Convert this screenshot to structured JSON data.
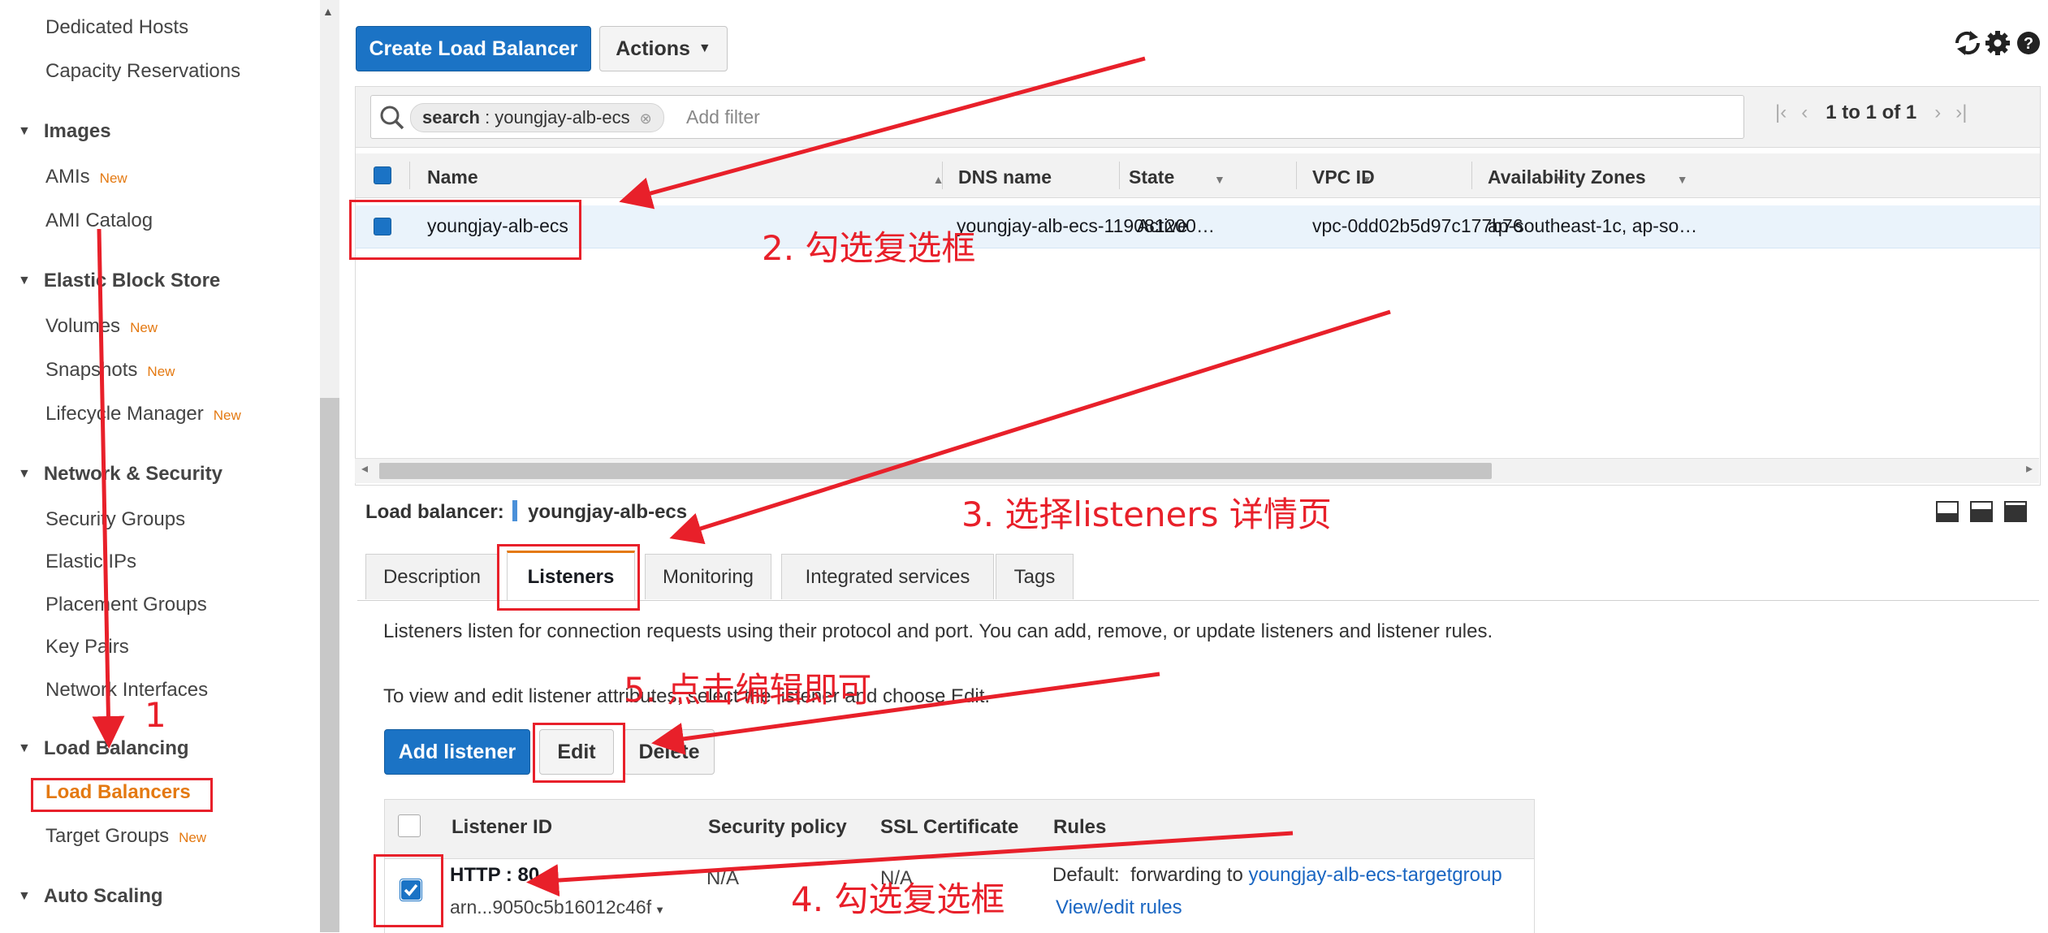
{
  "sidebar": {
    "items_top": [
      "Dedicated Hosts",
      "Capacity Reservations"
    ],
    "images": {
      "title": "Images",
      "items": [
        {
          "label": "AMIs",
          "badge": "New"
        },
        {
          "label": "AMI Catalog",
          "badge": ""
        }
      ]
    },
    "ebs": {
      "title": "Elastic Block Store",
      "items": [
        {
          "label": "Volumes",
          "badge": "New"
        },
        {
          "label": "Snapshots",
          "badge": "New"
        },
        {
          "label": "Lifecycle Manager",
          "badge": "New"
        }
      ]
    },
    "netsec": {
      "title": "Network & Security",
      "items": [
        {
          "label": "Security Groups"
        },
        {
          "label": "Elastic IPs"
        },
        {
          "label": "Placement Groups"
        },
        {
          "label": "Key Pairs"
        },
        {
          "label": "Network Interfaces"
        }
      ]
    },
    "lb": {
      "title": "Load Balancing",
      "items": [
        {
          "label": "Load Balancers",
          "badge": ""
        },
        {
          "label": "Target Groups",
          "badge": "New"
        }
      ]
    },
    "autoscaling": {
      "title": "Auto Scaling"
    }
  },
  "toolbar": {
    "create_label": "Create Load Balancer",
    "actions_label": "Actions"
  },
  "filter": {
    "chip_key": "search",
    "chip_sep": " : ",
    "chip_value": "youngjay-alb-ecs",
    "placeholder": "Add filter",
    "pagination": "1 to 1 of 1"
  },
  "table": {
    "columns": [
      "Name",
      "DNS name",
      "State",
      "VPC ID",
      "Availability Zones"
    ],
    "row": {
      "name": "youngjay-alb-ecs",
      "dns": "youngjay-alb-ecs-119081200…",
      "state": "Active",
      "vpc": "vpc-0dd02b5d97c177b76",
      "azs": "ap-southeast-1c, ap-so…"
    }
  },
  "details": {
    "lb_label": "Load balancer:",
    "lb_name": "youngjay-alb-ecs",
    "tabs": [
      "Description",
      "Listeners",
      "Monitoring",
      "Integrated services",
      "Tags"
    ],
    "intro": "Listeners listen for connection requests using their protocol and port. You can add, remove, or update listeners and listener rules.",
    "hint": "To view and edit listener attributes, select the listener and choose Edit.",
    "add_label": "Add listener",
    "edit_label": "Edit",
    "delete_label": "Delete",
    "lis_columns": [
      "Listener ID",
      "Security policy",
      "SSL Certificate",
      "Rules"
    ],
    "listener": {
      "id": "HTTP : 80",
      "arn": "arn...9050c5b16012c46f",
      "policy": "N/A",
      "cert": "N/A",
      "default_label": "Default:",
      "forward_label": "forwarding to",
      "target": "youngjay-alb-ecs-targetgroup",
      "view_rules": "View/edit rules"
    }
  },
  "annotations": {
    "step1": "1",
    "step2": "2. 勾选复选框",
    "step3": "3. 选择listeners 详情页",
    "step4": "4. 勾选复选框",
    "step5": "5. 点击编辑即可"
  },
  "colors": {
    "accent": "#e47911",
    "primary": "#1b73c5",
    "annotation": "#e8202a"
  }
}
